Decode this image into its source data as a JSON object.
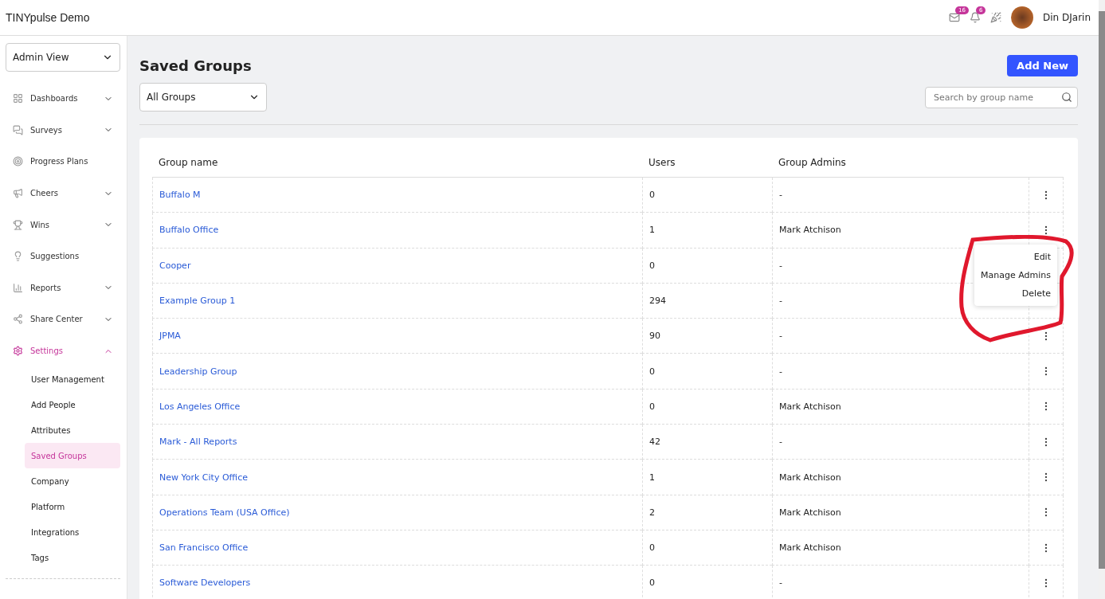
{
  "app": {
    "title": "TINYpulse Demo"
  },
  "header": {
    "messages_badge": "16",
    "notifications_badge": "6",
    "user_name": "Din DJarin"
  },
  "sidebar": {
    "view_select": "Admin View",
    "items": [
      {
        "label": "Dashboards",
        "expanded": false,
        "selected": false
      },
      {
        "label": "Surveys",
        "expanded": false,
        "selected": false
      },
      {
        "label": "Progress Plans",
        "selected": false
      },
      {
        "label": "Cheers",
        "expanded": false,
        "selected": false
      },
      {
        "label": "Wins",
        "expanded": false,
        "selected": false
      },
      {
        "label": "Suggestions",
        "selected": false
      },
      {
        "label": "Reports",
        "expanded": false,
        "selected": false
      },
      {
        "label": "Share Center",
        "expanded": false,
        "selected": false
      },
      {
        "label": "Settings",
        "expanded": true,
        "selected": true,
        "children": [
          {
            "label": "User Management",
            "selected": false
          },
          {
            "label": "Add People",
            "selected": false
          },
          {
            "label": "Attributes",
            "selected": false
          },
          {
            "label": "Saved Groups",
            "selected": true
          },
          {
            "label": "Company",
            "selected": false
          },
          {
            "label": "Platform",
            "selected": false
          },
          {
            "label": "Integrations",
            "selected": false
          },
          {
            "label": "Tags",
            "selected": false
          }
        ]
      }
    ]
  },
  "page": {
    "title": "Saved Groups",
    "add_button": "Add New",
    "filter_select": "All Groups",
    "search": {
      "placeholder": "Search by group name"
    }
  },
  "table": {
    "columns": [
      "Group name",
      "Users",
      "Group Admins"
    ],
    "rows": [
      {
        "name": "Buffalo M",
        "users": "0",
        "admins": "-"
      },
      {
        "name": "Buffalo Office",
        "users": "1",
        "admins": "Mark Atchison",
        "menu": [
          "Edit",
          "Manage Admins",
          "Delete"
        ]
      },
      {
        "name": "Cooper",
        "users": "0",
        "admins": "-"
      },
      {
        "name": "Example Group 1",
        "users": "294",
        "admins": "-"
      },
      {
        "name": "JPMA",
        "users": "90",
        "admins": "-"
      },
      {
        "name": "Leadership Group",
        "users": "0",
        "admins": "-"
      },
      {
        "name": "Los Angeles Office",
        "users": "0",
        "admins": "Mark Atchison"
      },
      {
        "name": "Mark - All Reports",
        "users": "42",
        "admins": "-"
      },
      {
        "name": "New York City Office",
        "users": "1",
        "admins": "Mark Atchison"
      },
      {
        "name": "Operations Team (USA Office)",
        "users": "2",
        "admins": "Mark Atchison"
      },
      {
        "name": "San Francisco Office",
        "users": "0",
        "admins": "Mark Atchison"
      },
      {
        "name": "Software Developers",
        "users": "0",
        "admins": "-"
      }
    ]
  }
}
